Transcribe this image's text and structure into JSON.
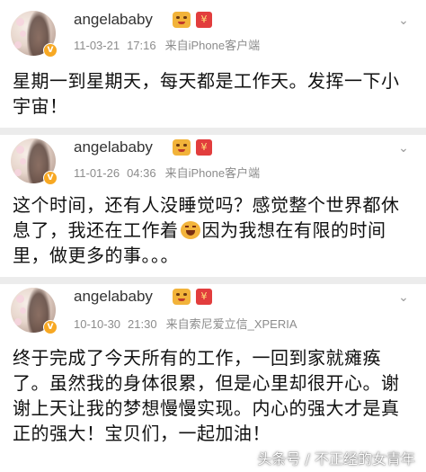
{
  "posts": [
    {
      "username": "angelababy",
      "date": "11-03-21",
      "time": "17:16",
      "source": "来自iPhone客户端",
      "text": "星期一到星期天，每天都是工作天。发挥一下小宇宙！"
    },
    {
      "username": "angelababy",
      "date": "11-01-26",
      "time": "04:36",
      "source": "来自iPhone客户端",
      "text_before_emoji": "这个时间，还有人没睡觉吗？感觉整个世界都休息了，我还在工作着",
      "text_after_emoji": "因为我想在有限的时间里，做更多的事。。。"
    },
    {
      "username": "angelababy",
      "date": "10-10-30",
      "time": "21:30",
      "source": "来自索尼爱立信_XPERIA",
      "text": "终于完成了今天所有的工作，一回到家就瘫痪了。虽然我的身体很累，但是心里却很开心。谢谢上天让我的梦想慢慢实现。内心的强大才是真正的强大！宝贝们，一起加油！"
    }
  ],
  "watermark": "头条号 / 不正经的女青年",
  "colors": {
    "username": "#333333",
    "meta": "#8c8c8c",
    "text": "#111111",
    "divider": "#ececec",
    "vip_badge": "#f7a823",
    "red_badge": "#e23d3d"
  },
  "icons": [
    "avatar",
    "verified-v-icon",
    "emoji-badge-icon",
    "red-envelope-icon",
    "chevron-down-icon",
    "grimace-emoji-icon"
  ]
}
